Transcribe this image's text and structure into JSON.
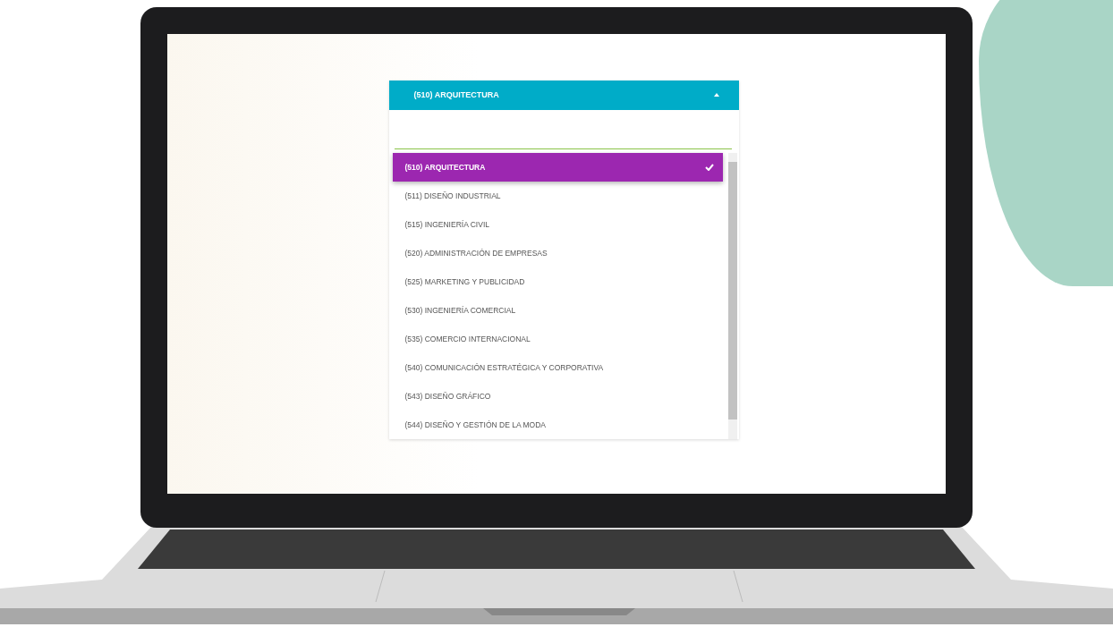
{
  "dropdown": {
    "value": "(510) ARQUITECTURA",
    "expanded": true,
    "options": [
      {
        "label": "(510) ARQUITECTURA",
        "selected": true
      },
      {
        "label": "(511) DISEÑO INDUSTRIAL",
        "selected": false
      },
      {
        "label": "(515) INGENIERÍA CIVIL",
        "selected": false
      },
      {
        "label": "(520) ADMINISTRACIÓN DE EMPRESAS",
        "selected": false
      },
      {
        "label": "(525) MARKETING Y PUBLICIDAD",
        "selected": false
      },
      {
        "label": "(530) INGENIERÍA COMERCIAL",
        "selected": false
      },
      {
        "label": "(535) COMERCIO INTERNACIONAL",
        "selected": false
      },
      {
        "label": "(540) COMUNICACIÓN ESTRATÉGICA Y CORPORATIVA",
        "selected": false
      },
      {
        "label": "(543) DISEÑO GRÁFICO",
        "selected": false
      },
      {
        "label": "(544) DISEÑO Y GESTIÓN DE LA MODA",
        "selected": false
      }
    ]
  }
}
